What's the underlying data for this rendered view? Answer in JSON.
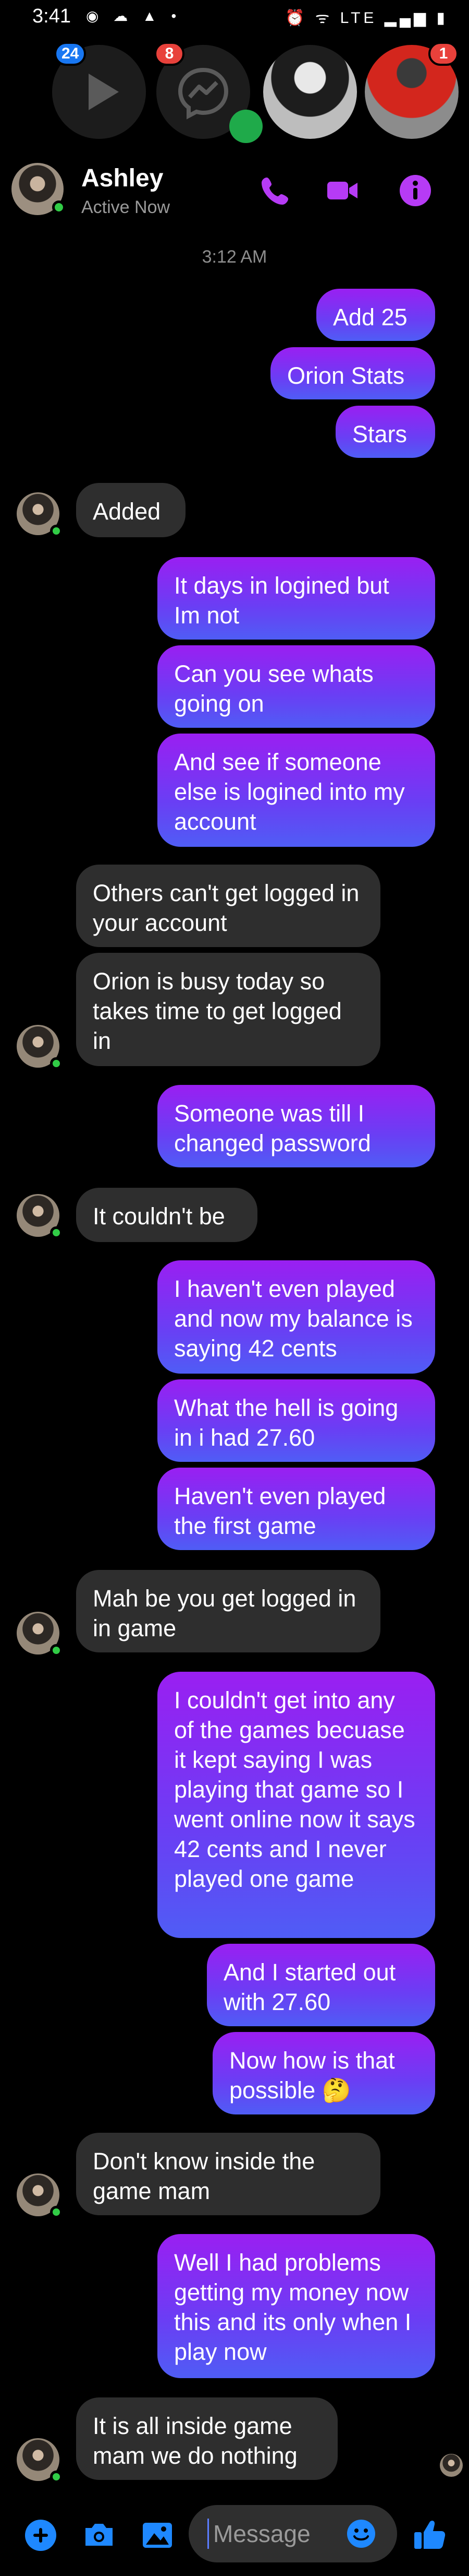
{
  "status_bar": {
    "time": "3:41",
    "left_icons": "◉ ☁ ▲ •",
    "right_icons": "⏰ ᯤ LTE ▂▄▆ ▮"
  },
  "chat_heads": [
    {
      "icon": "play-icon",
      "badge": "24",
      "badge_color": "#1877f2"
    },
    {
      "icon": "messenger-icon",
      "badge": "8",
      "badge_color": "#e8413b"
    },
    {
      "icon": "person-photo",
      "badge": ""
    },
    {
      "icon": "person-photo",
      "badge": "1",
      "badge_color": "#e8413b"
    }
  ],
  "header": {
    "name": "Ashley",
    "status": "Active Now",
    "accent": "#b63bf5"
  },
  "timestamp": "3:12 AM",
  "messages": [
    {
      "from": "me",
      "text": "Add 25"
    },
    {
      "from": "me",
      "text": "Orion Stats"
    },
    {
      "from": "me",
      "text": "Stars"
    },
    {
      "from": "them",
      "text": "Added"
    },
    {
      "from": "me",
      "text": "It days in logined but Im not"
    },
    {
      "from": "me",
      "text": "Can you see whats going on"
    },
    {
      "from": "me",
      "text": "And see if someone else is logined into my account"
    },
    {
      "from": "them",
      "text": "Others can't get logged in your account"
    },
    {
      "from": "them",
      "text": "Orion is busy today so takes time to get logged in"
    },
    {
      "from": "me",
      "text": "Someone was till I changed password"
    },
    {
      "from": "them",
      "text": "It couldn't be"
    },
    {
      "from": "me",
      "text": "I haven't even played and now my balance is saying 42 cents"
    },
    {
      "from": "me",
      "text": "What the hell is going in i had 27.60"
    },
    {
      "from": "me",
      "text": "Haven't even played the first game"
    },
    {
      "from": "them",
      "text": "Mah be you get logged in in game"
    },
    {
      "from": "me",
      "text": "I couldn't get into any of the games becuase it kept saying I was playing that game so I went online now it says 42 cents and I never played one game"
    },
    {
      "from": "me",
      "text": "And I started out with 27.60"
    },
    {
      "from": "me",
      "text": "Now how is that possible 🤔"
    },
    {
      "from": "them",
      "text": "Don't know inside the game mam"
    },
    {
      "from": "me",
      "text": "Well I had problems getting my money now this and its only when I play now"
    },
    {
      "from": "them",
      "text": "It is all inside game mam we do nothing"
    }
  ],
  "composer": {
    "placeholder": "Message",
    "accent": "#1e88ff"
  }
}
